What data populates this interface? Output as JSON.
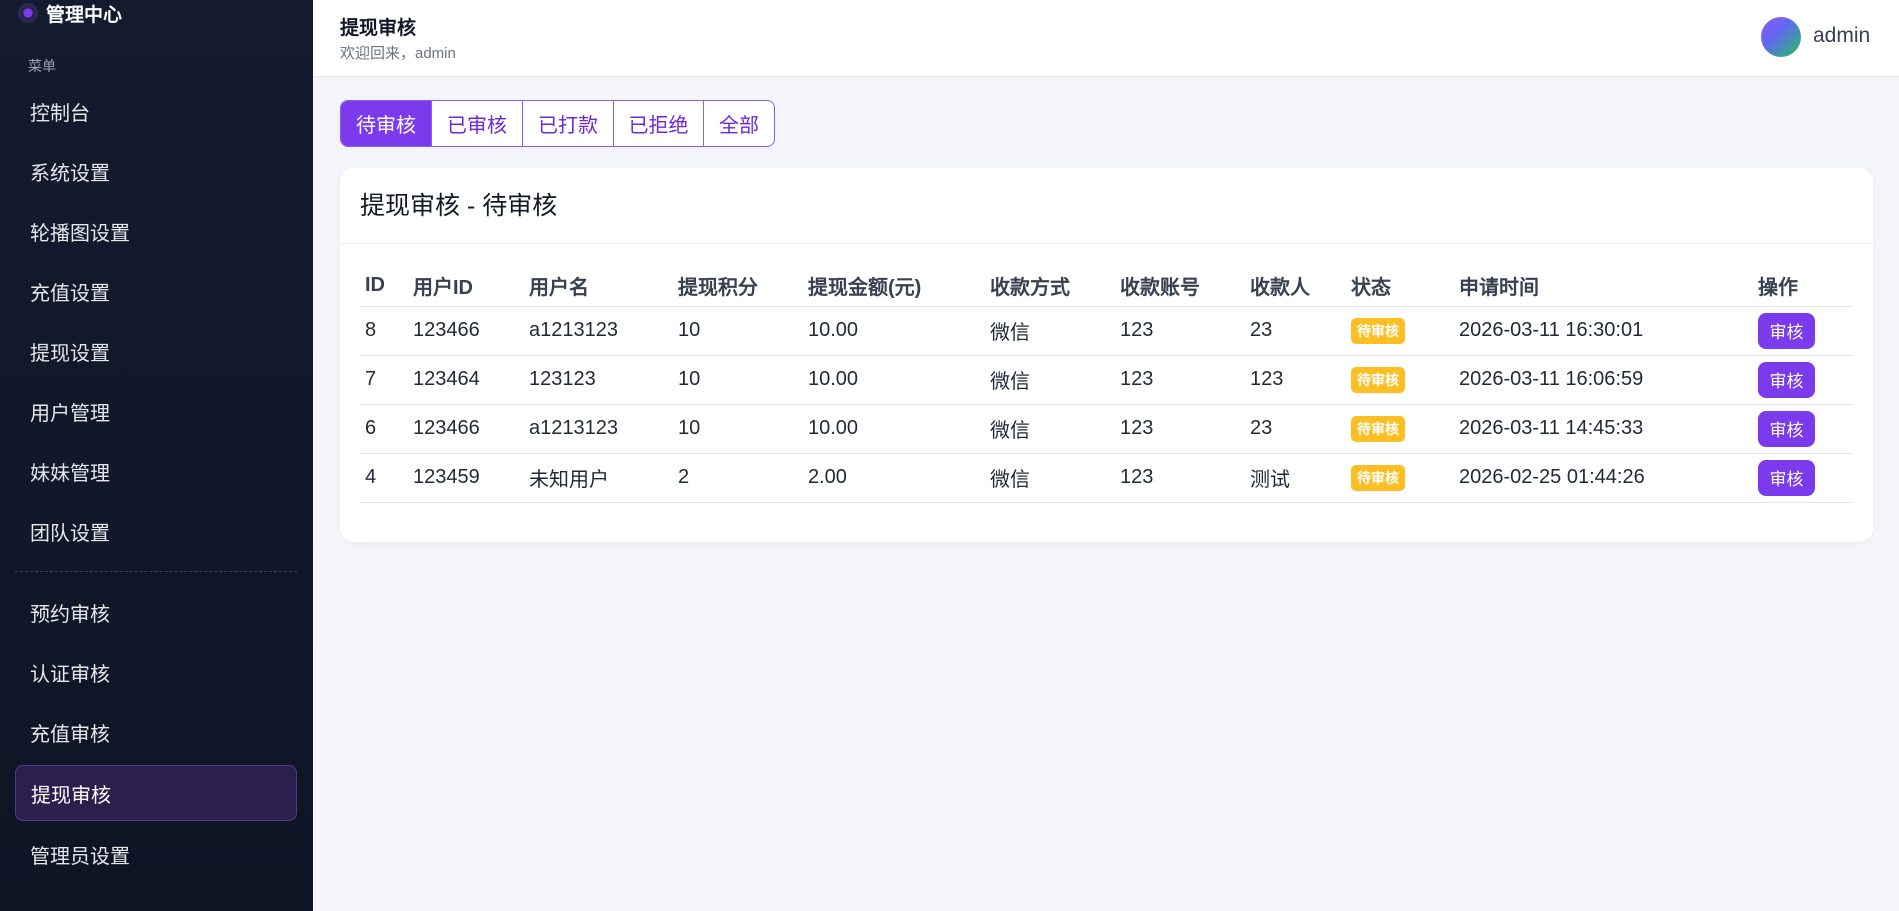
{
  "sidebar": {
    "brand": "管理中心",
    "caption": "菜单",
    "items": [
      {
        "label": "控制台"
      },
      {
        "label": "系统设置"
      },
      {
        "label": "轮播图设置"
      },
      {
        "label": "充值设置"
      },
      {
        "label": "提现设置"
      },
      {
        "label": "用户管理"
      },
      {
        "label": "妹妹管理"
      },
      {
        "label": "团队设置"
      },
      {
        "label": "预约审核"
      },
      {
        "label": "认证审核"
      },
      {
        "label": "充值审核"
      },
      {
        "label": "提现审核"
      },
      {
        "label": "管理员设置"
      }
    ],
    "active_index": 11
  },
  "header": {
    "title": "提现审核",
    "subtitle": "欢迎回来，admin",
    "user": "admin"
  },
  "tabs": [
    {
      "label": "待审核"
    },
    {
      "label": "已审核"
    },
    {
      "label": "已打款"
    },
    {
      "label": "已拒绝"
    },
    {
      "label": "全部"
    }
  ],
  "active_tab": 0,
  "card": {
    "title": "提现审核 - 待审核"
  },
  "table": {
    "columns": [
      "ID",
      "用户ID",
      "用户名",
      "提现积分",
      "提现金额(元)",
      "收款方式",
      "收款账号",
      "收款人",
      "状态",
      "申请时间",
      "操作"
    ],
    "rows": [
      {
        "id": "8",
        "user_id": "123466",
        "username": "a1213123",
        "points": "10",
        "amount": "10.00",
        "method": "微信",
        "account": "123",
        "payee": "23",
        "status": "待审核",
        "time": "2026-03-11 16:30:01",
        "action": "审核"
      },
      {
        "id": "7",
        "user_id": "123464",
        "username": "123123",
        "points": "10",
        "amount": "10.00",
        "method": "微信",
        "account": "123",
        "payee": "123",
        "status": "待审核",
        "time": "2026-03-11 16:06:59",
        "action": "审核"
      },
      {
        "id": "6",
        "user_id": "123466",
        "username": "a1213123",
        "points": "10",
        "amount": "10.00",
        "method": "微信",
        "account": "123",
        "payee": "23",
        "status": "待审核",
        "time": "2026-03-11 14:45:33",
        "action": "审核"
      },
      {
        "id": "4",
        "user_id": "123459",
        "username": "未知用户",
        "points": "2",
        "amount": "2.00",
        "method": "微信",
        "account": "123",
        "payee": "测试",
        "status": "待审核",
        "time": "2026-02-25 01:44:26",
        "action": "审核"
      }
    ]
  },
  "colors": {
    "accent": "#7c3aed",
    "sidebar_bg": "#131b2e",
    "badge": "#fbbf24"
  }
}
